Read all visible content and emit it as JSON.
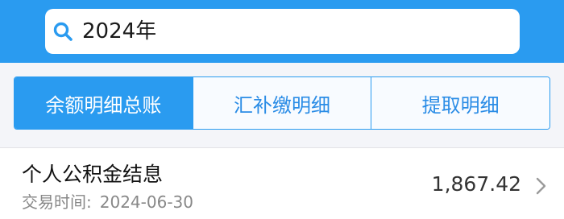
{
  "search": {
    "value": "2024年",
    "icon": "search-icon"
  },
  "tabs": [
    {
      "label": "余额明细总账",
      "active": true
    },
    {
      "label": "汇补缴明细",
      "active": false
    },
    {
      "label": "提取明细",
      "active": false
    }
  ],
  "records": [
    {
      "title": "个人公积金结息",
      "date_label": "交易时间:",
      "date": "2024-06-30",
      "amount": "1,867.42",
      "icon": "chevron-right-icon"
    }
  ],
  "colors": {
    "accent": "#2a9bf0",
    "tab_text": "#2a8ce6",
    "meta_text": "#888888"
  }
}
